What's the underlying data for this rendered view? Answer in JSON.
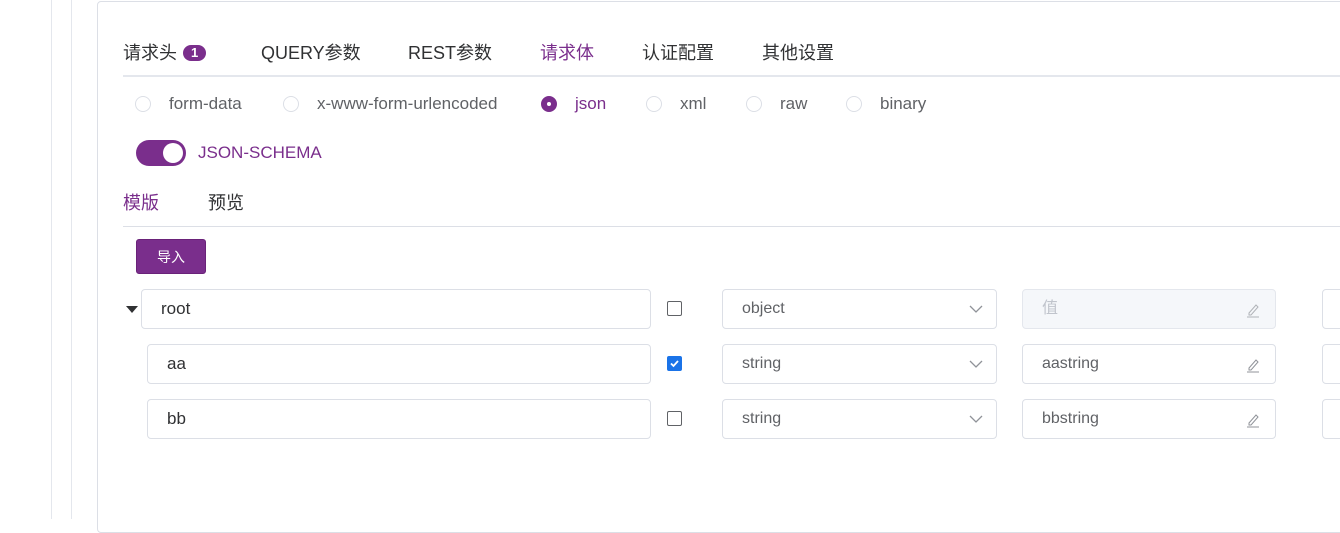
{
  "tabs": [
    {
      "label": "请求头",
      "badge": "1",
      "active": false
    },
    {
      "label": "QUERY参数",
      "active": false
    },
    {
      "label": "REST参数",
      "active": false
    },
    {
      "label": "请求体",
      "active": true
    },
    {
      "label": "认证配置",
      "active": false
    },
    {
      "label": "其他设置",
      "active": false
    }
  ],
  "body_types": [
    {
      "label": "form-data",
      "selected": false
    },
    {
      "label": "x-www-form-urlencoded",
      "selected": false
    },
    {
      "label": "json",
      "selected": true
    },
    {
      "label": "xml",
      "selected": false
    },
    {
      "label": "raw",
      "selected": false
    },
    {
      "label": "binary",
      "selected": false
    }
  ],
  "json_schema_switch": {
    "label": "JSON-SCHEMA",
    "on": true
  },
  "sub_tabs": [
    {
      "label": "模版",
      "active": true
    },
    {
      "label": "预览",
      "active": false
    }
  ],
  "import_button": "导入",
  "rows": [
    {
      "name": "root",
      "required": false,
      "type": "object",
      "value": "",
      "value_placeholder": "值",
      "value_disabled": true,
      "expandable": true
    },
    {
      "name": "aa",
      "required": true,
      "type": "string",
      "value": "aastring",
      "value_disabled": false
    },
    {
      "name": "bb",
      "required": false,
      "type": "string",
      "value": "bbstring",
      "value_disabled": false
    }
  ],
  "colors": {
    "accent": "#7a2e8c",
    "checkbox_checked": "#1a73e8"
  },
  "icons": {
    "type_select": "chevron-down-icon",
    "value_edit": "pencil-icon",
    "tree_toggle": "caret-down-icon"
  }
}
